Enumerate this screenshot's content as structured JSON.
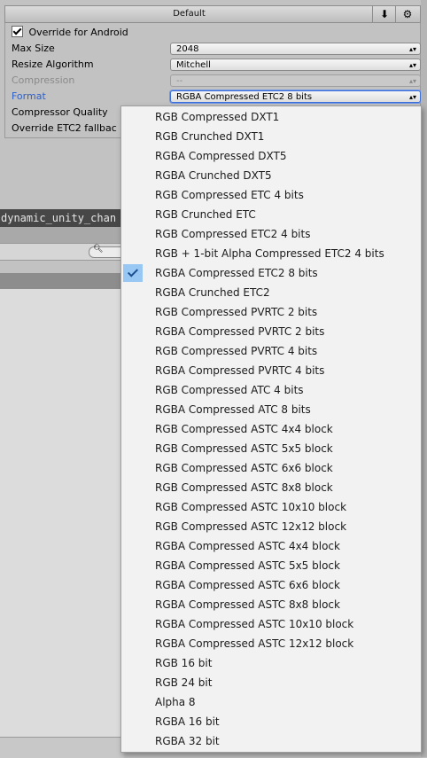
{
  "tabbar": {
    "default_label": "Default",
    "icons": [
      "download-icon",
      "android-icon"
    ]
  },
  "settings": {
    "override_label": "Override for Android",
    "override_checked": true,
    "max_size": {
      "label": "Max Size",
      "value": "2048"
    },
    "resize": {
      "label": "Resize Algorithm",
      "value": "Mitchell"
    },
    "compression": {
      "label": "Compression",
      "value": "--"
    },
    "format": {
      "label": "Format",
      "value": "RGBA Compressed ETC2 8 bits"
    },
    "compressor_quality": {
      "label": "Compressor Quality"
    },
    "override_etc2": {
      "label": "Override ETC2 fallbac"
    }
  },
  "background": {
    "object_name": "dynamic_unity_chan"
  },
  "dropdown": {
    "selected_index": 8,
    "options": [
      "RGB Compressed DXT1",
      "RGB Crunched DXT1",
      "RGBA Compressed DXT5",
      "RGBA Crunched DXT5",
      "RGB Compressed ETC 4 bits",
      "RGB Crunched ETC",
      "RGB Compressed ETC2 4 bits",
      "RGB + 1-bit Alpha Compressed ETC2 4 bits",
      "RGBA Compressed ETC2 8 bits",
      "RGBA Crunched ETC2",
      "RGB Compressed PVRTC 2 bits",
      "RGBA Compressed PVRTC 2 bits",
      "RGB Compressed PVRTC 4 bits",
      "RGBA Compressed PVRTC 4 bits",
      "RGB Compressed ATC 4 bits",
      "RGBA Compressed ATC 8 bits",
      "RGB Compressed ASTC 4x4 block",
      "RGB Compressed ASTC 5x5 block",
      "RGB Compressed ASTC 6x6 block",
      "RGB Compressed ASTC 8x8 block",
      "RGB Compressed ASTC 10x10 block",
      "RGB Compressed ASTC 12x12 block",
      "RGBA Compressed ASTC 4x4 block",
      "RGBA Compressed ASTC 5x5 block",
      "RGBA Compressed ASTC 6x6 block",
      "RGBA Compressed ASTC 8x8 block",
      "RGBA Compressed ASTC 10x10 block",
      "RGBA Compressed ASTC 12x12 block",
      "RGB 16 bit",
      "RGB 24 bit",
      "Alpha 8",
      "RGBA 16 bit",
      "RGBA 32 bit"
    ]
  },
  "colors": {
    "selection": "#97c7f2",
    "format_label": "#2d5fc7",
    "dropdown_bg": "#f2f2f2"
  }
}
